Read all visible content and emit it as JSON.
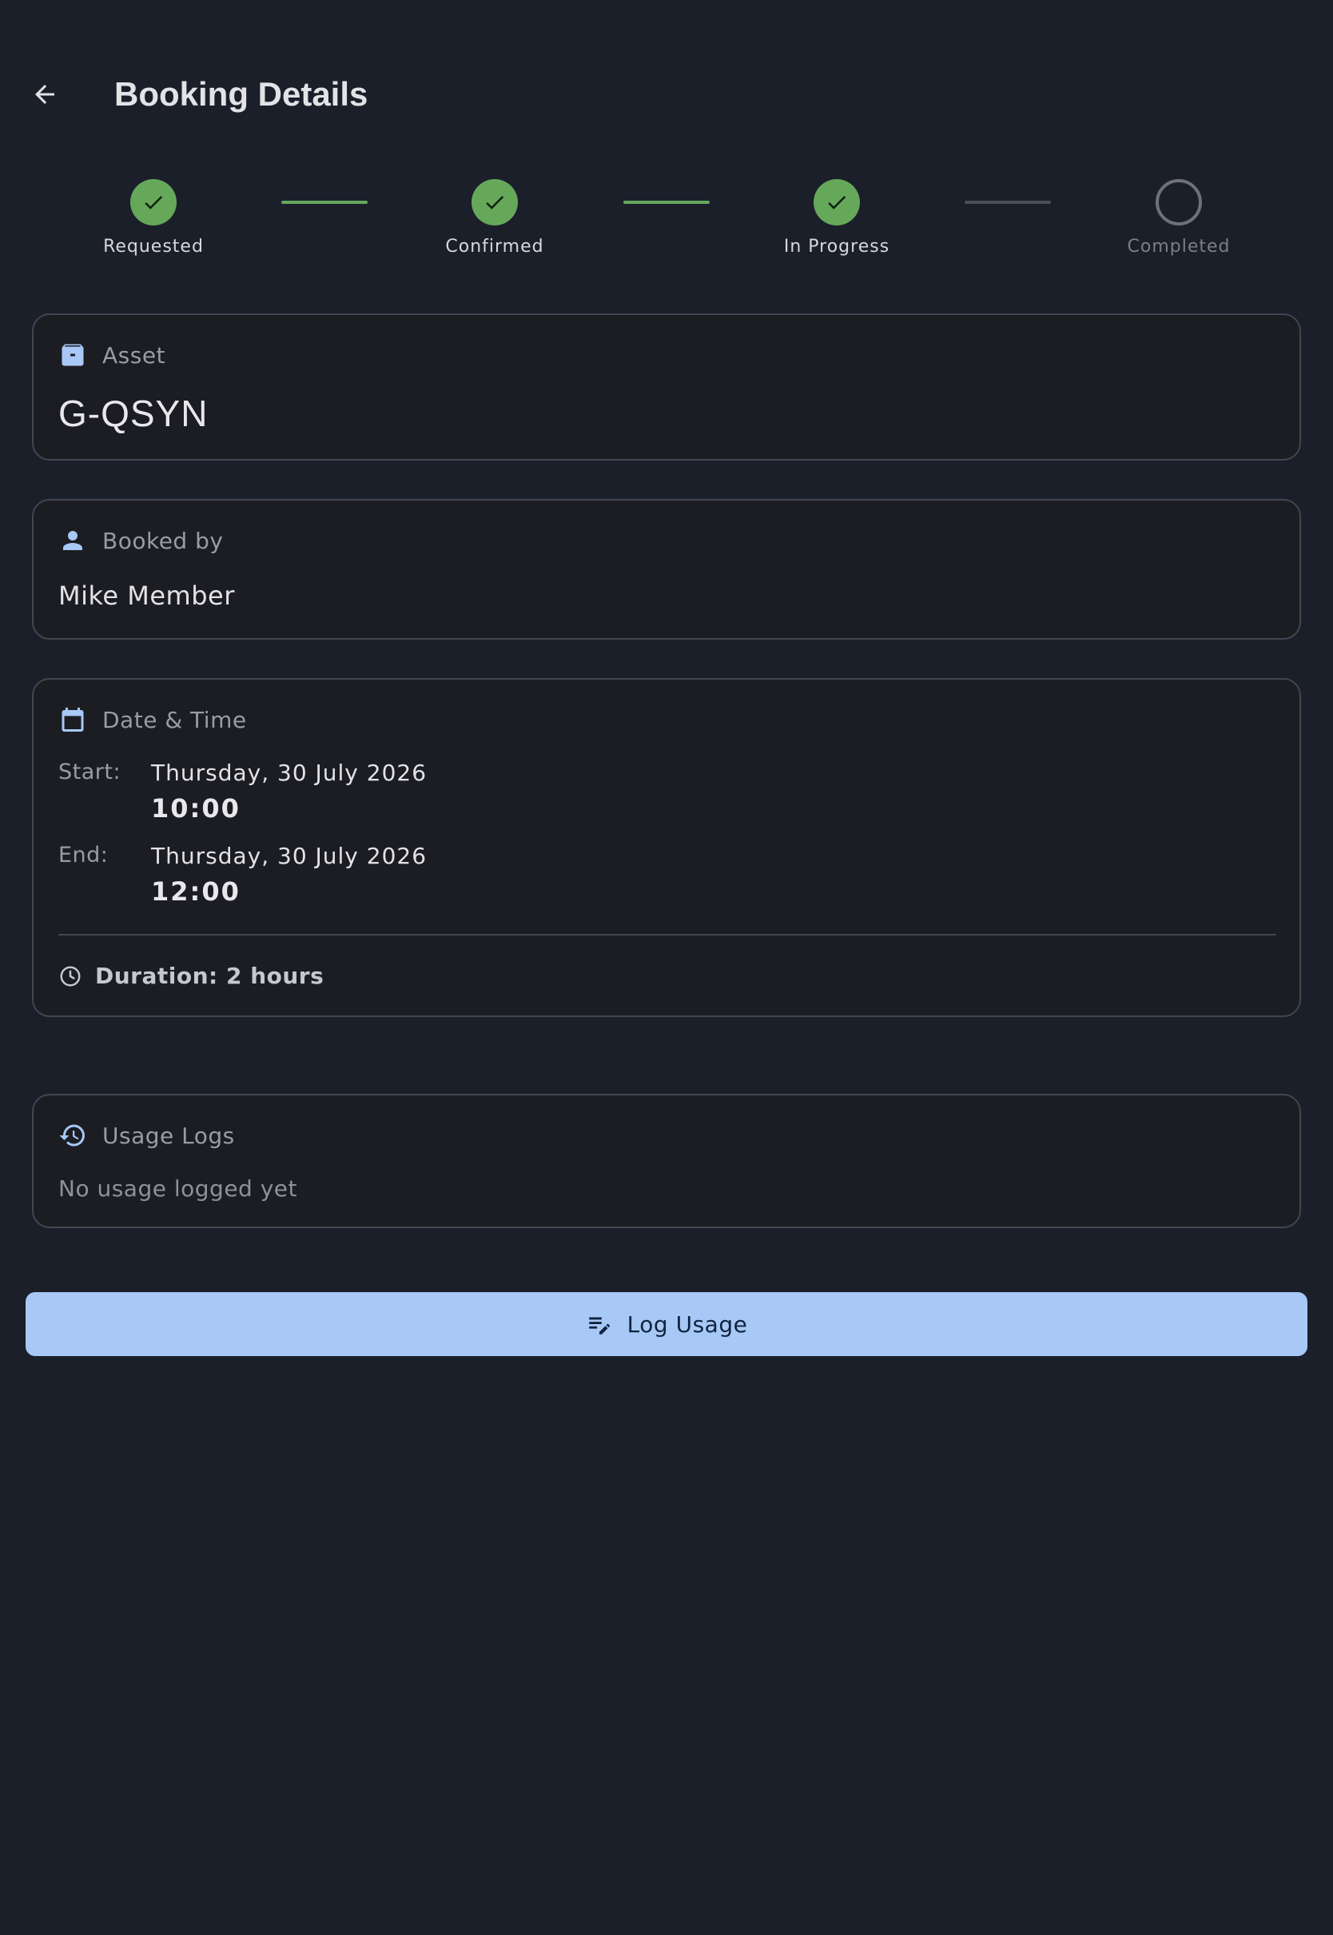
{
  "app_bar": {
    "title": "Booking Details",
    "back_icon": "arrow-left-icon"
  },
  "stepper": {
    "steps": [
      {
        "label": "Requested",
        "state": "done"
      },
      {
        "label": "Confirmed",
        "state": "done"
      },
      {
        "label": "In Progress",
        "state": "done"
      },
      {
        "label": "Completed",
        "state": "todo"
      }
    ],
    "colors": {
      "done": "#66a85a",
      "todo": "#6f7178"
    }
  },
  "asset": {
    "label": "Asset",
    "value": "G-QSYN",
    "icon": "archive-box-icon"
  },
  "booked_by": {
    "label": "Booked by",
    "value": "Mike Member",
    "icon": "person-icon"
  },
  "date_time": {
    "label": "Date & Time",
    "icon": "calendar-icon",
    "start": {
      "key": "Start:",
      "date": "Thursday, 30 July 2026",
      "time": "10:00"
    },
    "end": {
      "key": "End:",
      "date": "Thursday, 30 July 2026",
      "time": "12:00"
    },
    "duration": "Duration: 2 hours",
    "duration_icon": "clock-icon"
  },
  "usage_logs": {
    "label": "Usage Logs",
    "icon": "history-icon",
    "empty_text": "No usage logged yet"
  },
  "log_button": {
    "label": "Log Usage",
    "icon": "edit-note-icon"
  },
  "colors": {
    "background": "#1b1f2a",
    "accent": "#a8c8f5",
    "icon_accent": "#a8c8f5",
    "success": "#66a85a"
  }
}
